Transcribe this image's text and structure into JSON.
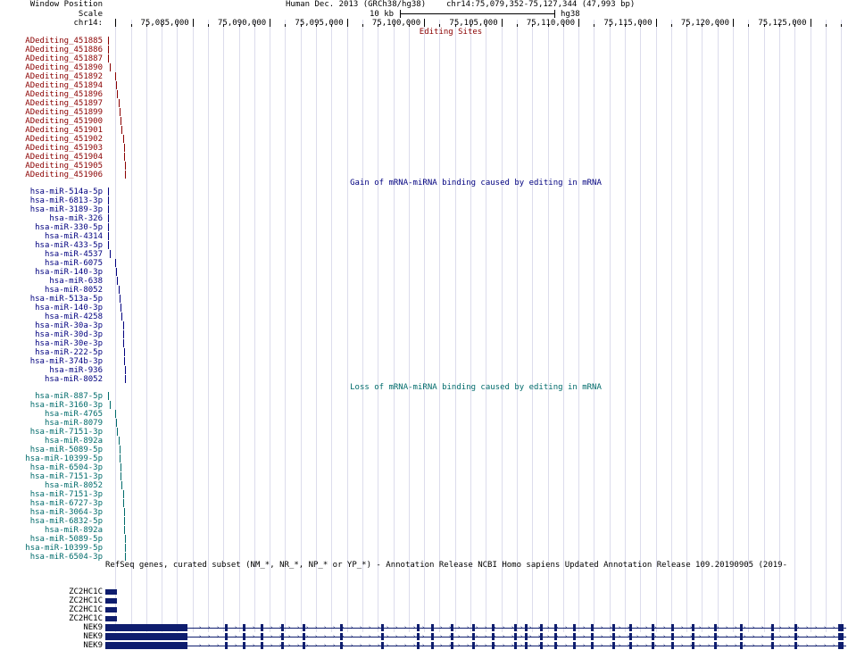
{
  "header": {
    "window_position_label": "Window Position",
    "scale_label": "Scale",
    "chrom_label": "chr14:",
    "assembly": "Human Dec. 2013 (GRCh38/hg38)",
    "position": "chr14:75,079,352-75,127,344 (47,993 bp)",
    "scale_value": "10 kb",
    "scale_assembly": "hg38",
    "ticks": [
      "75,085,000",
      "75,090,000",
      "75,095,000",
      "75,100,000",
      "75,105,000",
      "75,110,000",
      "75,115,000",
      "75,120,000",
      "75,125,000"
    ]
  },
  "view": {
    "start": 75079352,
    "end": 75127344
  },
  "colors": {
    "editing": "#8b0000",
    "gain": "#00007f",
    "loss": "#006b6b",
    "genes": "#0e1d6e"
  },
  "tracks": {
    "editing": {
      "title": "Editing Sites",
      "items": [
        {
          "label": "ADediting_451885",
          "pos": 75079512
        },
        {
          "label": "ADediting_451886",
          "pos": 75079520
        },
        {
          "label": "ADediting_451887",
          "pos": 75079530
        },
        {
          "label": "ADediting_451890",
          "pos": 75079640
        },
        {
          "label": "ADediting_451892",
          "pos": 75080000
        },
        {
          "label": "ADediting_451894",
          "pos": 75080060
        },
        {
          "label": "ADediting_451896",
          "pos": 75080120
        },
        {
          "label": "ADediting_451897",
          "pos": 75080190
        },
        {
          "label": "ADediting_451899",
          "pos": 75080260
        },
        {
          "label": "ADediting_451900",
          "pos": 75080330
        },
        {
          "label": "ADediting_451901",
          "pos": 75080400
        },
        {
          "label": "ADediting_451902",
          "pos": 75080480
        },
        {
          "label": "ADediting_451903",
          "pos": 75080540
        },
        {
          "label": "ADediting_451904",
          "pos": 75080570
        },
        {
          "label": "ADediting_451905",
          "pos": 75080600
        },
        {
          "label": "ADediting_451906",
          "pos": 75080640
        }
      ]
    },
    "gain": {
      "title": "Gain of mRNA-miRNA binding caused by editing in mRNA",
      "items": [
        {
          "label": "hsa-miR-514a-5p",
          "pos": 75079512
        },
        {
          "label": "hsa-miR-6813-3p",
          "pos": 75079512
        },
        {
          "label": "hsa-miR-3189-3p",
          "pos": 75079520
        },
        {
          "label": "hsa-miR-326",
          "pos": 75079520
        },
        {
          "label": "hsa-miR-330-5p",
          "pos": 75079525
        },
        {
          "label": "hsa-miR-4314",
          "pos": 75079525
        },
        {
          "label": "hsa-miR-433-5p",
          "pos": 75079530
        },
        {
          "label": "hsa-miR-4537",
          "pos": 75079640
        },
        {
          "label": "hsa-miR-6075",
          "pos": 75080000
        },
        {
          "label": "hsa-miR-140-3p",
          "pos": 75080060
        },
        {
          "label": "hsa-miR-638",
          "pos": 75080120
        },
        {
          "label": "hsa-miR-8052",
          "pos": 75080190
        },
        {
          "label": "hsa-miR-513a-5p",
          "pos": 75080260
        },
        {
          "label": "hsa-miR-140-3p",
          "pos": 75080330
        },
        {
          "label": "hsa-miR-4258",
          "pos": 75080400
        },
        {
          "label": "hsa-miR-30a-3p",
          "pos": 75080480
        },
        {
          "label": "hsa-miR-30d-3p",
          "pos": 75080480
        },
        {
          "label": "hsa-miR-30e-3p",
          "pos": 75080480
        },
        {
          "label": "hsa-miR-222-5p",
          "pos": 75080540
        },
        {
          "label": "hsa-miR-374b-3p",
          "pos": 75080570
        },
        {
          "label": "hsa-miR-936",
          "pos": 75080600
        },
        {
          "label": "hsa-miR-8052",
          "pos": 75080640
        }
      ]
    },
    "loss": {
      "title": "Loss of mRNA-miRNA binding caused by editing in mRNA",
      "items": [
        {
          "label": "hsa-miR-887-5p",
          "pos": 75079512
        },
        {
          "label": "hsa-miR-3160-3p",
          "pos": 75079640
        },
        {
          "label": "hsa-miR-4765",
          "pos": 75080000
        },
        {
          "label": "hsa-miR-8079",
          "pos": 75080060
        },
        {
          "label": "hsa-miR-7151-3p",
          "pos": 75080120
        },
        {
          "label": "hsa-miR-892a",
          "pos": 75080190
        },
        {
          "label": "hsa-miR-5089-5p",
          "pos": 75080260
        },
        {
          "label": "hsa-miR-10399-5p",
          "pos": 75080260
        },
        {
          "label": "hsa-miR-6504-3p",
          "pos": 75080330
        },
        {
          "label": "hsa-miR-7151-3p",
          "pos": 75080330
        },
        {
          "label": "hsa-miR-8052",
          "pos": 75080400
        },
        {
          "label": "hsa-miR-7151-3p",
          "pos": 75080480
        },
        {
          "label": "hsa-miR-6727-3p",
          "pos": 75080480
        },
        {
          "label": "hsa-miR-3064-3p",
          "pos": 75080540
        },
        {
          "label": "hsa-miR-6832-5p",
          "pos": 75080540
        },
        {
          "label": "hsa-miR-892a",
          "pos": 75080570
        },
        {
          "label": "hsa-miR-5089-5p",
          "pos": 75080600
        },
        {
          "label": "hsa-miR-10399-5p",
          "pos": 75080600
        },
        {
          "label": "hsa-miR-6504-3p",
          "pos": 75080640
        }
      ]
    },
    "genes": {
      "title": "RefSeq genes, curated subset (NM_*, NR_*, NP_* or YP_*) - Annotation Release NCBI Homo sapiens Updated Annotation Release 109.20190905 (2019-",
      "items": [
        {
          "label": "ZC2HC1C",
          "type": "zc",
          "start": 75079352,
          "end": 75080100
        },
        {
          "label": "ZC2HC1C",
          "type": "zc",
          "start": 75079352,
          "end": 75080100
        },
        {
          "label": "ZC2HC1C",
          "type": "zc",
          "start": 75079352,
          "end": 75080100
        },
        {
          "label": "ZC2HC1C",
          "type": "zc",
          "start": 75079352,
          "end": 75080100
        },
        {
          "label": "NEK9",
          "type": "nek"
        },
        {
          "label": "NEK9",
          "type": "nek"
        },
        {
          "label": "NEK9",
          "type": "nek"
        }
      ]
    }
  }
}
